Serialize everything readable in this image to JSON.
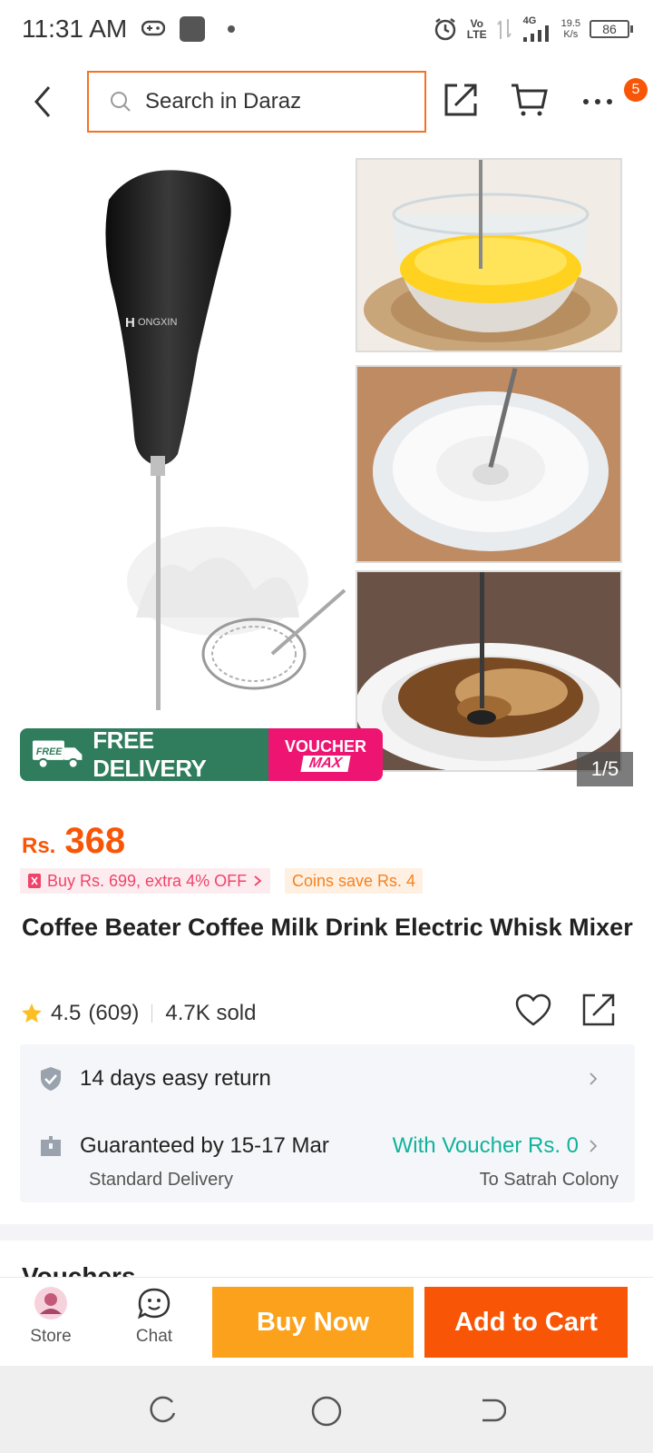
{
  "status_bar": {
    "time": "11:31 AM",
    "network_label_top": "Vo",
    "network_label_bottom": "LTE",
    "signal_label": "4G",
    "speed_value": "19.5",
    "speed_unit": "K/s",
    "battery": "86",
    "icons": [
      "gamepad-icon",
      "app-square-icon",
      "dot-icon",
      "alarm-icon",
      "signal-icon",
      "battery-icon"
    ]
  },
  "header": {
    "search_placeholder": "Search in Daraz",
    "cart_badge": "5",
    "icons": [
      "back-arrow-icon",
      "search-icon",
      "share-icon",
      "cart-icon",
      "more-icon"
    ]
  },
  "gallery": {
    "brand_text": "ONGXIN",
    "promo_free_small": "FREE",
    "promo_free_label": "FREE DELIVERY",
    "promo_voucher_top": "VOUCHER",
    "promo_voucher_bottom": "MAX",
    "pager": "1/5"
  },
  "product": {
    "currency": "Rs.",
    "price": "368",
    "promo_chip": "Buy Rs. 699, extra 4% OFF",
    "coins_chip": "Coins save Rs. 4",
    "title": "Coffee Beater Coffee Milk Drink Electric Whisk Mixer",
    "rating": "4.5",
    "rating_count": "(609)",
    "sold": "4.7K sold"
  },
  "info": {
    "return_text": "14 days easy return",
    "delivery_text": "Guaranteed by 15-17 Mar",
    "voucher_text": "With Voucher Rs. 0",
    "delivery_type": "Standard Delivery",
    "delivery_location": "To Satrah Colony"
  },
  "vouchers_section_title": "Vouchers",
  "bottom_bar": {
    "store_label": "Store",
    "chat_label": "Chat",
    "buy_now": "Buy Now",
    "add_to_cart": "Add to Cart"
  },
  "colors": {
    "accent": "#f85606",
    "buy_now": "#fca11b",
    "voucher_green": "#10b39b",
    "promo_green": "#2f7d5c",
    "promo_pink": "#ee1572"
  }
}
